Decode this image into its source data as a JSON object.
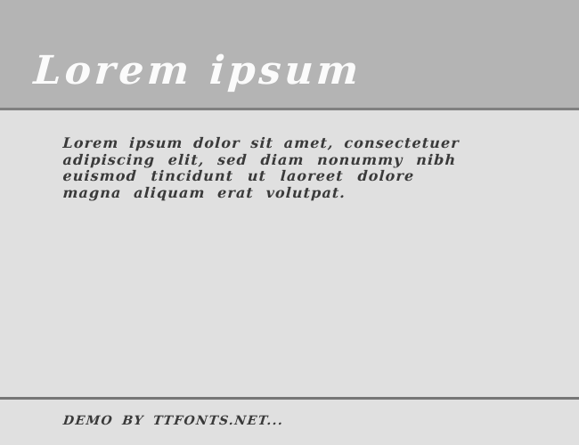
{
  "page": {
    "background_color": "#e0e0e0"
  },
  "header": {
    "title": "Lorem ipsum",
    "background_color": "#b4b4b4",
    "text_color": "#fbfbfb",
    "rule_color": "#808080"
  },
  "sample": {
    "text_color": "#3a3a3a",
    "lines": [
      "Lorem ipsum dolor sit amet, consectetuer",
      "adipiscing elit, sed diam nonummy nibh",
      "euismod tincidunt ut laoreet dolore",
      "magna aliquam erat volutpat."
    ]
  },
  "footer": {
    "credit": "DEMO BY TTFONTS.NET...",
    "rule_color": "#767676",
    "text_color": "#3a3a3a"
  }
}
